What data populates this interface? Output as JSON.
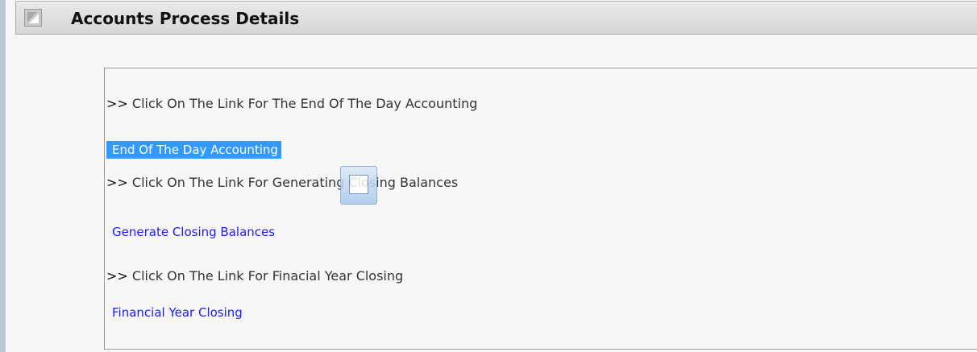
{
  "header": {
    "title": "Accounts Process Details",
    "icon": "collapse-corner-icon"
  },
  "sections": [
    {
      "arrows": ">>",
      "instruction": "Click On The Link For The End Of The Day Accounting",
      "link_label": "End Of The Day Accounting",
      "selected": true
    },
    {
      "arrows": ">>",
      "instruction": "Click On The Link For Generating Closing Balances",
      "link_label": "Generate Closing Balances",
      "selected": false
    },
    {
      "arrows": ">>",
      "instruction": "Click On The Link For Finacial Year Closing",
      "link_label": "Financial Year Closing",
      "selected": false
    }
  ],
  "overlay": {
    "icon": "expand-window-icon"
  },
  "colors": {
    "link": "#1a1aff",
    "selection": "#3399ff",
    "header_bg": "#d6d6d6"
  }
}
